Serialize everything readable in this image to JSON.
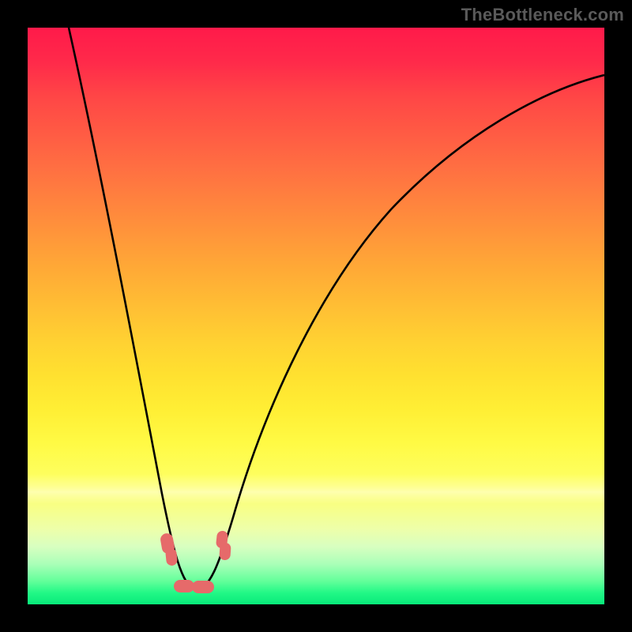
{
  "watermark": "TheBottleneck.com",
  "chart_data": {
    "type": "line",
    "title": "",
    "xlabel": "",
    "ylabel": "",
    "xlim": [
      0,
      100
    ],
    "ylim": [
      0,
      100
    ],
    "grid": false,
    "x": [
      0,
      2,
      4,
      6,
      8,
      10,
      12,
      14,
      16,
      18,
      20,
      22,
      24,
      26,
      28,
      30,
      31,
      32,
      33,
      34,
      35,
      36,
      38,
      40,
      42,
      44,
      46,
      48,
      50,
      54,
      58,
      62,
      66,
      70,
      74,
      78,
      82,
      86,
      90,
      94,
      98,
      100
    ],
    "series": [
      {
        "name": "bottleneck-curve",
        "values": [
          100,
          90.0,
          80.5,
          71.4,
          62.8,
          54.6,
          46.8,
          39.4,
          32.6,
          26.2,
          20.4,
          15.2,
          10.6,
          6.7,
          3.6,
          1.3,
          0.5,
          0.0,
          0.2,
          1.0,
          2.5,
          4.5,
          8.5,
          13.0,
          17.5,
          22.0,
          26.3,
          30.5,
          34.5,
          41.0,
          46.7,
          51.8,
          56.4,
          60.6,
          64.4,
          67.8,
          70.8,
          73.5,
          76.0,
          78.2,
          80.2,
          81.0
        ]
      }
    ],
    "markers": [
      {
        "x": 24,
        "y": 10,
        "shape": "pill"
      },
      {
        "x": 25,
        "y": 7,
        "shape": "pill"
      },
      {
        "x": 34,
        "y": 11,
        "shape": "pill"
      },
      {
        "x": 34.5,
        "y": 8,
        "shape": "pill"
      },
      {
        "x": 27,
        "y": 2,
        "shape": "pill"
      },
      {
        "x": 31,
        "y": 2,
        "shape": "pill"
      }
    ],
    "gradient_bands": [
      {
        "color": "#ff1a4a",
        "stop": 0
      },
      {
        "color": "#ffd032",
        "stop": 54
      },
      {
        "color": "#feff60",
        "stop": 78
      },
      {
        "color": "#08ea7a",
        "stop": 100
      }
    ]
  }
}
